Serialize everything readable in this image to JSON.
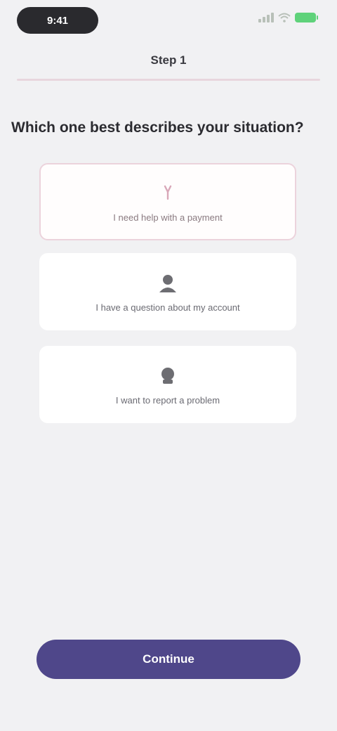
{
  "status_bar": {
    "time": "9:41",
    "battery_color": "#5fd27a",
    "icons": [
      "signal-icon",
      "wifi-icon",
      "battery-icon"
    ]
  },
  "header": {
    "title": "Step 1"
  },
  "question": "Which one best describes your situation?",
  "options": [
    {
      "label": "I need help with a payment",
      "icon": "card-icon",
      "selected": true
    },
    {
      "label": "I have a question about my account",
      "icon": "user-icon",
      "selected": false
    },
    {
      "label": "I want to report a problem",
      "icon": "flag-icon",
      "selected": false
    }
  ],
  "cta": {
    "label": "Continue",
    "color": "#4f478a"
  },
  "colors": {
    "background": "#f1f1f3",
    "selected_border": "#ecd3dc",
    "accent": "#4f478a"
  }
}
